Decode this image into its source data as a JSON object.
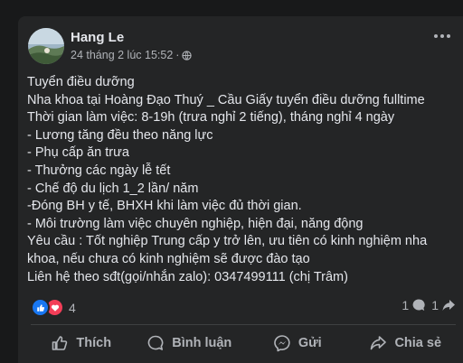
{
  "post": {
    "author": "Hang Le",
    "timestamp": "24 tháng 2 lúc 15:52",
    "separator": "·",
    "privacy_icon": "globe-icon",
    "body_lines": [
      "Tuyển điều dưỡng",
      "Nha khoa tại Hoàng Đạo Thuý _ Cầu Giấy tuyển điều dưỡng fulltime",
      "Thời gian làm việc: 8-19h (trưa nghỉ 2 tiếng), tháng nghỉ 4 ngày",
      "- Lương tăng đều theo năng lực",
      "- Phụ cấp ăn trưa",
      "- Thưởng các ngày lễ tết",
      "- Chế độ du lịch 1_2 lần/ năm",
      "-Đóng BH y tế, BHXH khi làm việc đủ thời gian.",
      "- Môi trường làm việc chuyên nghiệp, hiện đại, năng động",
      "Yêu cầu : Tốt nghiệp Trung cấp y trở lên, ưu tiên có kinh nghiệm nha",
      "khoa, nếu chưa có kinh nghiệm sẽ được đào tạo",
      "Liên hệ theo sđt(gọi/nhắn zalo): 0347499111 (chị Trâm)"
    ],
    "reactions_count": "4",
    "comments_count": "1",
    "shares_count": "1"
  },
  "actions": {
    "like": "Thích",
    "comment": "Bình luận",
    "send": "Gửi",
    "share": "Chia sẻ"
  },
  "colors": {
    "page_bg": "#18191a",
    "card_bg": "#242526",
    "text_primary": "#e4e6eb",
    "text_secondary": "#b0b3b8",
    "like_blue": "#1877f2",
    "love_red": "#f33e58"
  }
}
